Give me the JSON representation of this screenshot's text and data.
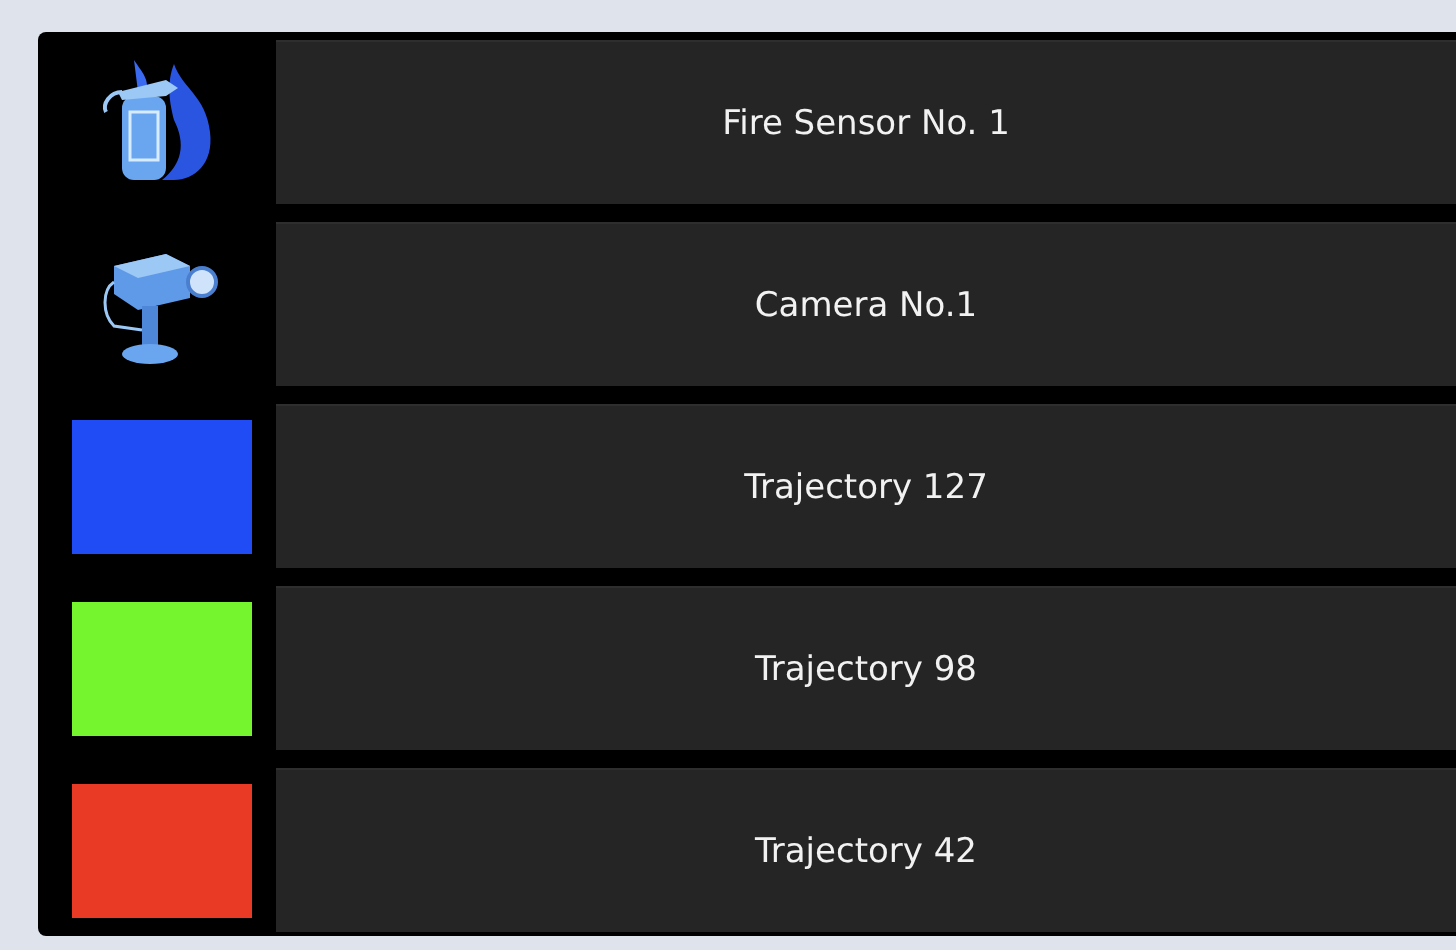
{
  "items": [
    {
      "kind": "fire-sensor",
      "label": "Fire Sensor No. 1"
    },
    {
      "kind": "camera",
      "label": "Camera No.1"
    },
    {
      "kind": "trajectory",
      "label": "Trajectory 127",
      "color": "#1f4cf5"
    },
    {
      "kind": "trajectory",
      "label": "Trajectory 98",
      "color": "#74f52d"
    },
    {
      "kind": "trajectory",
      "label": "Trajectory 42",
      "color": "#e83a24"
    }
  ]
}
